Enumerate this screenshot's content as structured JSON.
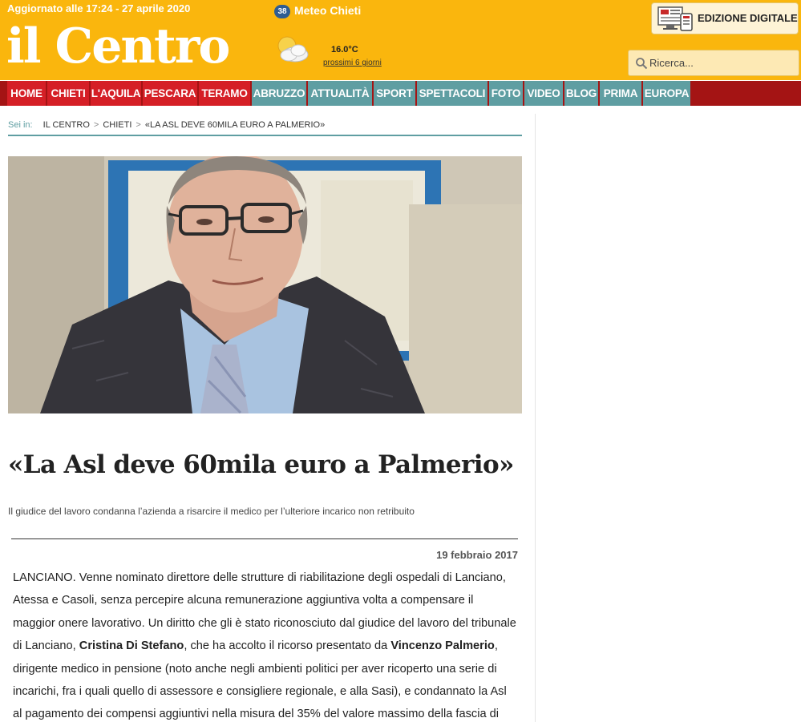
{
  "header": {
    "updated": "Aggiornato alle 17:24 - 27 aprile 2020",
    "logo": "il Centro",
    "meteo": {
      "badge": "38",
      "title": "Meteo Chieti",
      "temperature": "16.0°C",
      "forecast_link": "prossimi 6 giorni",
      "icon": "partly-cloudy-icon"
    },
    "edition_button": "EDIZIONE DIGITALE",
    "search_placeholder": "Ricerca..."
  },
  "nav": {
    "items": [
      {
        "label": "HOME",
        "group": "city"
      },
      {
        "label": "CHIETI",
        "group": "city"
      },
      {
        "label": "L'AQUILA",
        "group": "city"
      },
      {
        "label": "PESCARA",
        "group": "city"
      },
      {
        "label": "TERAMO",
        "group": "city"
      },
      {
        "label": "ABRUZZO",
        "group": "section"
      },
      {
        "label": "ATTUALITÀ",
        "group": "section"
      },
      {
        "label": "SPORT",
        "group": "section"
      },
      {
        "label": "SPETTACOLI",
        "group": "section"
      },
      {
        "label": "FOTO",
        "group": "section"
      },
      {
        "label": "VIDEO",
        "group": "section"
      },
      {
        "label": "BLOG",
        "group": "section"
      },
      {
        "label": "PRIMA",
        "group": "section"
      },
      {
        "label": "EUROPA",
        "group": "section"
      }
    ]
  },
  "breadcrumb": {
    "label": "Sei in:",
    "items": [
      "IL CENTRO",
      "CHIETI",
      "«LA ASL DEVE 60MILA EURO A PALMERIO»"
    ]
  },
  "article": {
    "title": "«La Asl deve 60mila euro a Palmerio»",
    "subtitle": "Il giudice del lavoro condanna l’azienda a risarcire il medico per l’ulteriore incarico non retribuito",
    "date": "19 febbraio 2017",
    "body": {
      "p1": "LANCIANO. Venne nominato direttore delle strutture di riabilitazione degli ospedali di Lanciano, Atessa e Casoli, senza percepire alcuna remunerazione aggiuntiva volta a compensare il maggior onere lavorativo. Un diritto che gli è stato riconosciuto dal giudice del lavoro del tribunale di Lanciano,",
      "name1": "Cristina Di Stefano",
      "p2": ", che ha accolto il ricorso presentato da",
      "name2": "Vincenzo Palmerio",
      "p3": ", dirigente medico in pensione (noto anche negli ambienti politici per aver ricoperto una serie di incarichi, fra i quali quello di assessore e consigliere regionale, e alla Sasi), e condannato la Asl al pagamento dei compensi aggiuntivi nella misura del 35% del valore massimo della fascia di appartenenza,"
    }
  },
  "colors": {
    "header_bg": "#fab60d",
    "nav_bg": "#a41414",
    "nav_city": "#d51f26",
    "nav_section": "#5f9ea2",
    "accent_teal": "#5f9ea2"
  }
}
